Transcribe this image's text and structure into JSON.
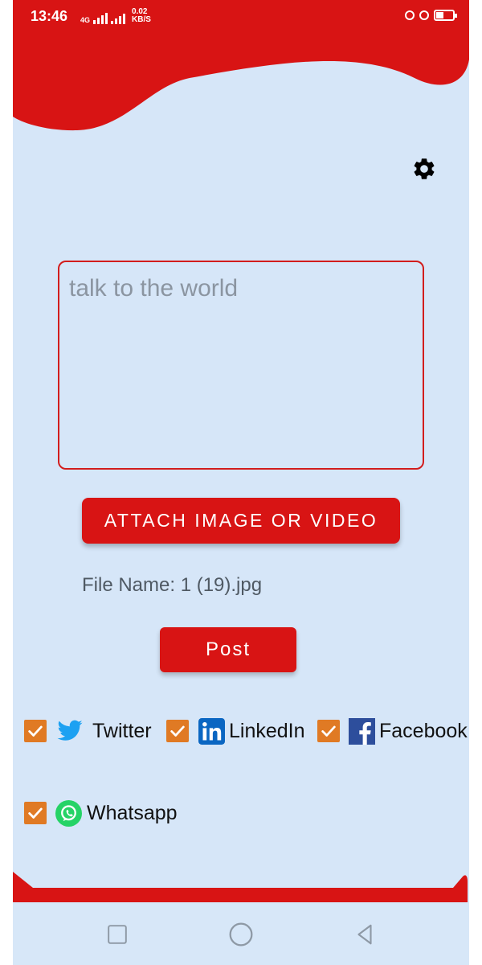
{
  "status_bar": {
    "time": "13:46",
    "network": "4G",
    "speed_value": "0.02",
    "speed_unit": "KB/S",
    "battery_level": 0.45
  },
  "header": {
    "settings_icon": "gear-icon"
  },
  "composer": {
    "placeholder": "talk to the world",
    "value": ""
  },
  "actions": {
    "attach_label": "ATTACH IMAGE OR VIDEO",
    "file_name": "File Name: 1 (19).jpg",
    "post_label": "Post"
  },
  "platforms": [
    {
      "label": "Twitter",
      "checked": true,
      "icon": "twitter-icon"
    },
    {
      "label": "LinkedIn",
      "checked": true,
      "icon": "linkedin-icon"
    },
    {
      "label": "Facebook",
      "checked": true,
      "icon": "facebook-icon"
    },
    {
      "label": "Whatsapp",
      "checked": true,
      "icon": "whatsapp-icon"
    }
  ],
  "nav_bar": {
    "recent_icon": "square-icon",
    "home_icon": "circle-icon",
    "back_icon": "triangle-back-icon"
  },
  "colors": {
    "brand_red": "#d81414",
    "background": "#d6e6f8",
    "checkbox": "#e07a24",
    "twitter": "#1da1f2",
    "linkedin": "#0a66c2",
    "facebook": "#2d4e9c",
    "whatsapp": "#25d366"
  }
}
